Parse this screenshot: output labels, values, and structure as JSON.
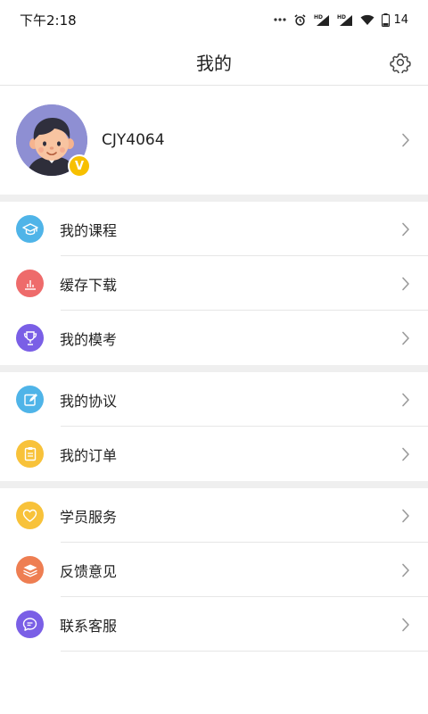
{
  "status_bar": {
    "time": "下午2:18",
    "battery": "14"
  },
  "header": {
    "title": "我的"
  },
  "profile": {
    "username": "CJY4064",
    "badge": "V"
  },
  "groups": [
    {
      "items": [
        {
          "label": "我的课程",
          "icon": "graduation-cap-icon",
          "color": "#4fb4e8"
        },
        {
          "label": "缓存下载",
          "icon": "bar-chart-icon",
          "color": "#ee6b6b"
        },
        {
          "label": "我的模考",
          "icon": "trophy-icon",
          "color": "#7a5fe6"
        }
      ]
    },
    {
      "items": [
        {
          "label": "我的协议",
          "icon": "edit-document-icon",
          "color": "#4fb4e8"
        },
        {
          "label": "我的订单",
          "icon": "clipboard-icon",
          "color": "#f8c23a"
        }
      ]
    },
    {
      "items": [
        {
          "label": "学员服务",
          "icon": "heart-icon",
          "color": "#f8c23a"
        },
        {
          "label": "反馈意见",
          "icon": "stack-icon",
          "color": "#ee7e52"
        },
        {
          "label": "联系客服",
          "icon": "chat-bubble-icon",
          "color": "#7a5fe6"
        }
      ]
    }
  ],
  "colors": {
    "separator": "#efefef",
    "divider": "#e6e6e6",
    "chevron": "#9a9a9a"
  }
}
